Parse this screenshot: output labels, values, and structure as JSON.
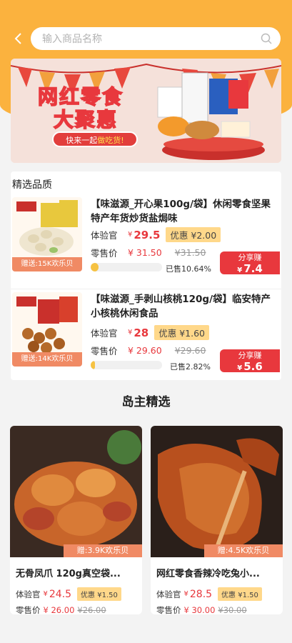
{
  "search": {
    "placeholder": "输入商品名称"
  },
  "banner": {
    "title_line1": "网红零食",
    "title_line2": "大聚惠",
    "cta_prefix": "快来一起",
    "cta_highlight": "做吃货!"
  },
  "featured": {
    "heading": "精选品质",
    "products": [
      {
        "title": "【味滋源_开心果100g/袋】休闲零食坚果特产年货炒货盐焗味",
        "gift": "赠送:15K欢乐贝",
        "trial_label": "体验官",
        "trial_price": "29.5",
        "coupon": "优惠 ¥2.00",
        "retail_label": "零售价",
        "retail_price": "¥ 31.50",
        "original_price": "¥31.50",
        "sold_text": "已售10.64%",
        "sold_fraction": 0.1064,
        "share_label": "分享赚",
        "share_value": "7.4"
      },
      {
        "title": "【味滋源_手剥山核桃120g/袋】临安特产小核桃休闲食品",
        "gift": "赠送:14K欢乐贝",
        "trial_label": "体验官",
        "trial_price": "28",
        "coupon": "优惠 ¥1.60",
        "retail_label": "零售价",
        "retail_price": "¥ 29.60",
        "original_price": "¥29.60",
        "sold_text": "已售2.82%",
        "sold_fraction": 0.0282,
        "share_label": "分享赚",
        "share_value": "5.6"
      }
    ]
  },
  "section_title": "岛主精选",
  "cards": [
    {
      "gift": "赠:3.9K欢乐贝",
      "title": "无骨凤爪 120g真空袋...",
      "trial_label": "体验官",
      "trial_price": "24.5",
      "coupon": "优惠 ¥1.50",
      "retail_label": "零售价",
      "retail_price": "¥ 26.00",
      "original_price": "¥26.00"
    },
    {
      "gift": "赠:4.5K欢乐贝",
      "title": "网红零食香辣冷吃兔小...",
      "trial_label": "体验官",
      "trial_price": "28.5",
      "coupon": "优惠 ¥1.50",
      "retail_label": "零售价",
      "retail_price": "¥ 30.00",
      "original_price": "¥30.00"
    }
  ],
  "colors": {
    "accent": "#fbb23e",
    "price_red": "#e8383d",
    "coupon_bg": "#ffd88a"
  },
  "icons": {
    "back": "chevron-left-icon",
    "search": "search-icon"
  }
}
